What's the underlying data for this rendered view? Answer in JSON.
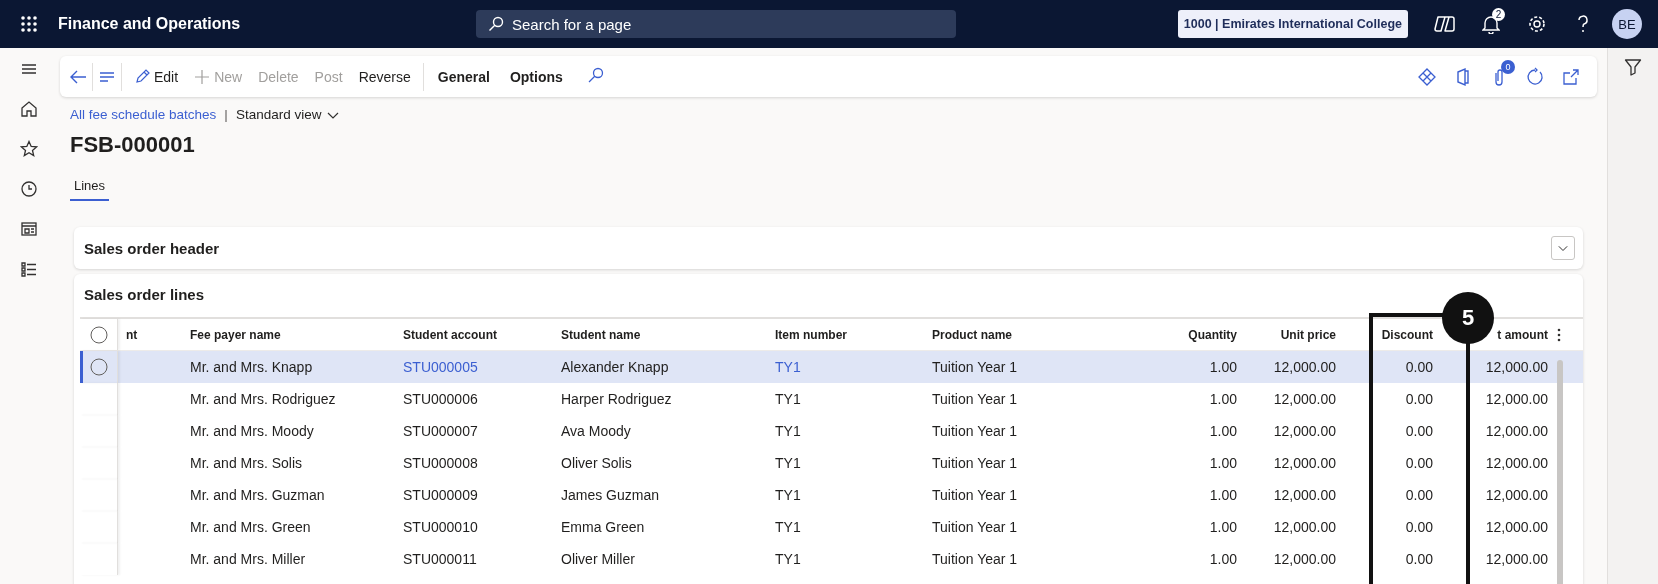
{
  "app": {
    "title": "Finance and Operations",
    "search_placeholder": "Search for a page",
    "company": "1000 | Emirates International College",
    "notifications": "2",
    "avatar": "BE"
  },
  "toolbar": {
    "actions": [
      {
        "label": "Edit",
        "disabled": false
      },
      {
        "label": "New",
        "disabled": true
      },
      {
        "label": "Delete",
        "disabled": true
      },
      {
        "label": "Post",
        "disabled": true
      },
      {
        "label": "Reverse",
        "disabled": false
      }
    ],
    "menus": [
      "General",
      "Options"
    ],
    "attachments": "0"
  },
  "breadcrumb": {
    "link": "All fee schedule batches",
    "separator": "|",
    "view": "Standard view"
  },
  "title": "FSB-000001",
  "tabs": [
    {
      "label": "Lines",
      "selected": true
    }
  ],
  "header_section": {
    "title": "Sales order header",
    "expanded": false
  },
  "lines_section": {
    "title": "Sales order lines",
    "all_checked": false,
    "columns": [
      {
        "label": "nt",
        "kind": "text"
      },
      {
        "label": "Fee payer name",
        "kind": "text",
        "link": false
      },
      {
        "label": "Student account",
        "kind": "text",
        "link": true
      },
      {
        "label": "Student name",
        "kind": "text",
        "link": false
      },
      {
        "label": "Item number",
        "kind": "text",
        "link": true
      },
      {
        "label": "Product name",
        "kind": "text",
        "link": false
      },
      {
        "label": "Quantity",
        "kind": "number",
        "link": false
      },
      {
        "label": "Unit price",
        "kind": "number",
        "link": false
      },
      {
        "label": "Discount",
        "kind": "number",
        "link": false
      },
      {
        "label": "t amount",
        "kind": "number",
        "link": false
      }
    ],
    "rows": [
      {
        "selected": true,
        "checked": false,
        "cells": [
          "",
          "Mr. and Mrs. Knapp",
          "STU000005",
          "Alexander Knapp",
          "TY1",
          "Tuition Year 1",
          "1.00",
          "12,000.00",
          "0.00",
          "12,000.00"
        ]
      },
      {
        "selected": false,
        "cells": [
          "",
          "Mr. and Mrs. Rodriguez",
          "STU000006",
          "Harper Rodriguez",
          "TY1",
          "Tuition Year 1",
          "1.00",
          "12,000.00",
          "0.00",
          "12,000.00"
        ]
      },
      {
        "selected": false,
        "cells": [
          "",
          "Mr. and Mrs. Moody",
          "STU000007",
          "Ava Moody",
          "TY1",
          "Tuition Year 1",
          "1.00",
          "12,000.00",
          "0.00",
          "12,000.00"
        ]
      },
      {
        "selected": false,
        "cells": [
          "",
          "Mr. and Mrs. Solis",
          "STU000008",
          "Oliver Solis",
          "TY1",
          "Tuition Year 1",
          "1.00",
          "12,000.00",
          "0.00",
          "12,000.00"
        ]
      },
      {
        "selected": false,
        "cells": [
          "",
          "Mr. and Mrs. Guzman",
          "STU000009",
          "James Guzman",
          "TY1",
          "Tuition Year 1",
          "1.00",
          "12,000.00",
          "0.00",
          "12,000.00"
        ]
      },
      {
        "selected": false,
        "cells": [
          "",
          "Mr. and Mrs. Green",
          "STU000010",
          "Emma Green",
          "TY1",
          "Tuition Year 1",
          "1.00",
          "12,000.00",
          "0.00",
          "12,000.00"
        ]
      },
      {
        "selected": false,
        "cells": [
          "",
          "Mr. and Mrs. Miller",
          "STU000011",
          "Oliver Miller",
          "TY1",
          "Tuition Year 1",
          "1.00",
          "12,000.00",
          "0.00",
          "12,000.00"
        ]
      }
    ]
  },
  "callout": {
    "label": "5"
  }
}
